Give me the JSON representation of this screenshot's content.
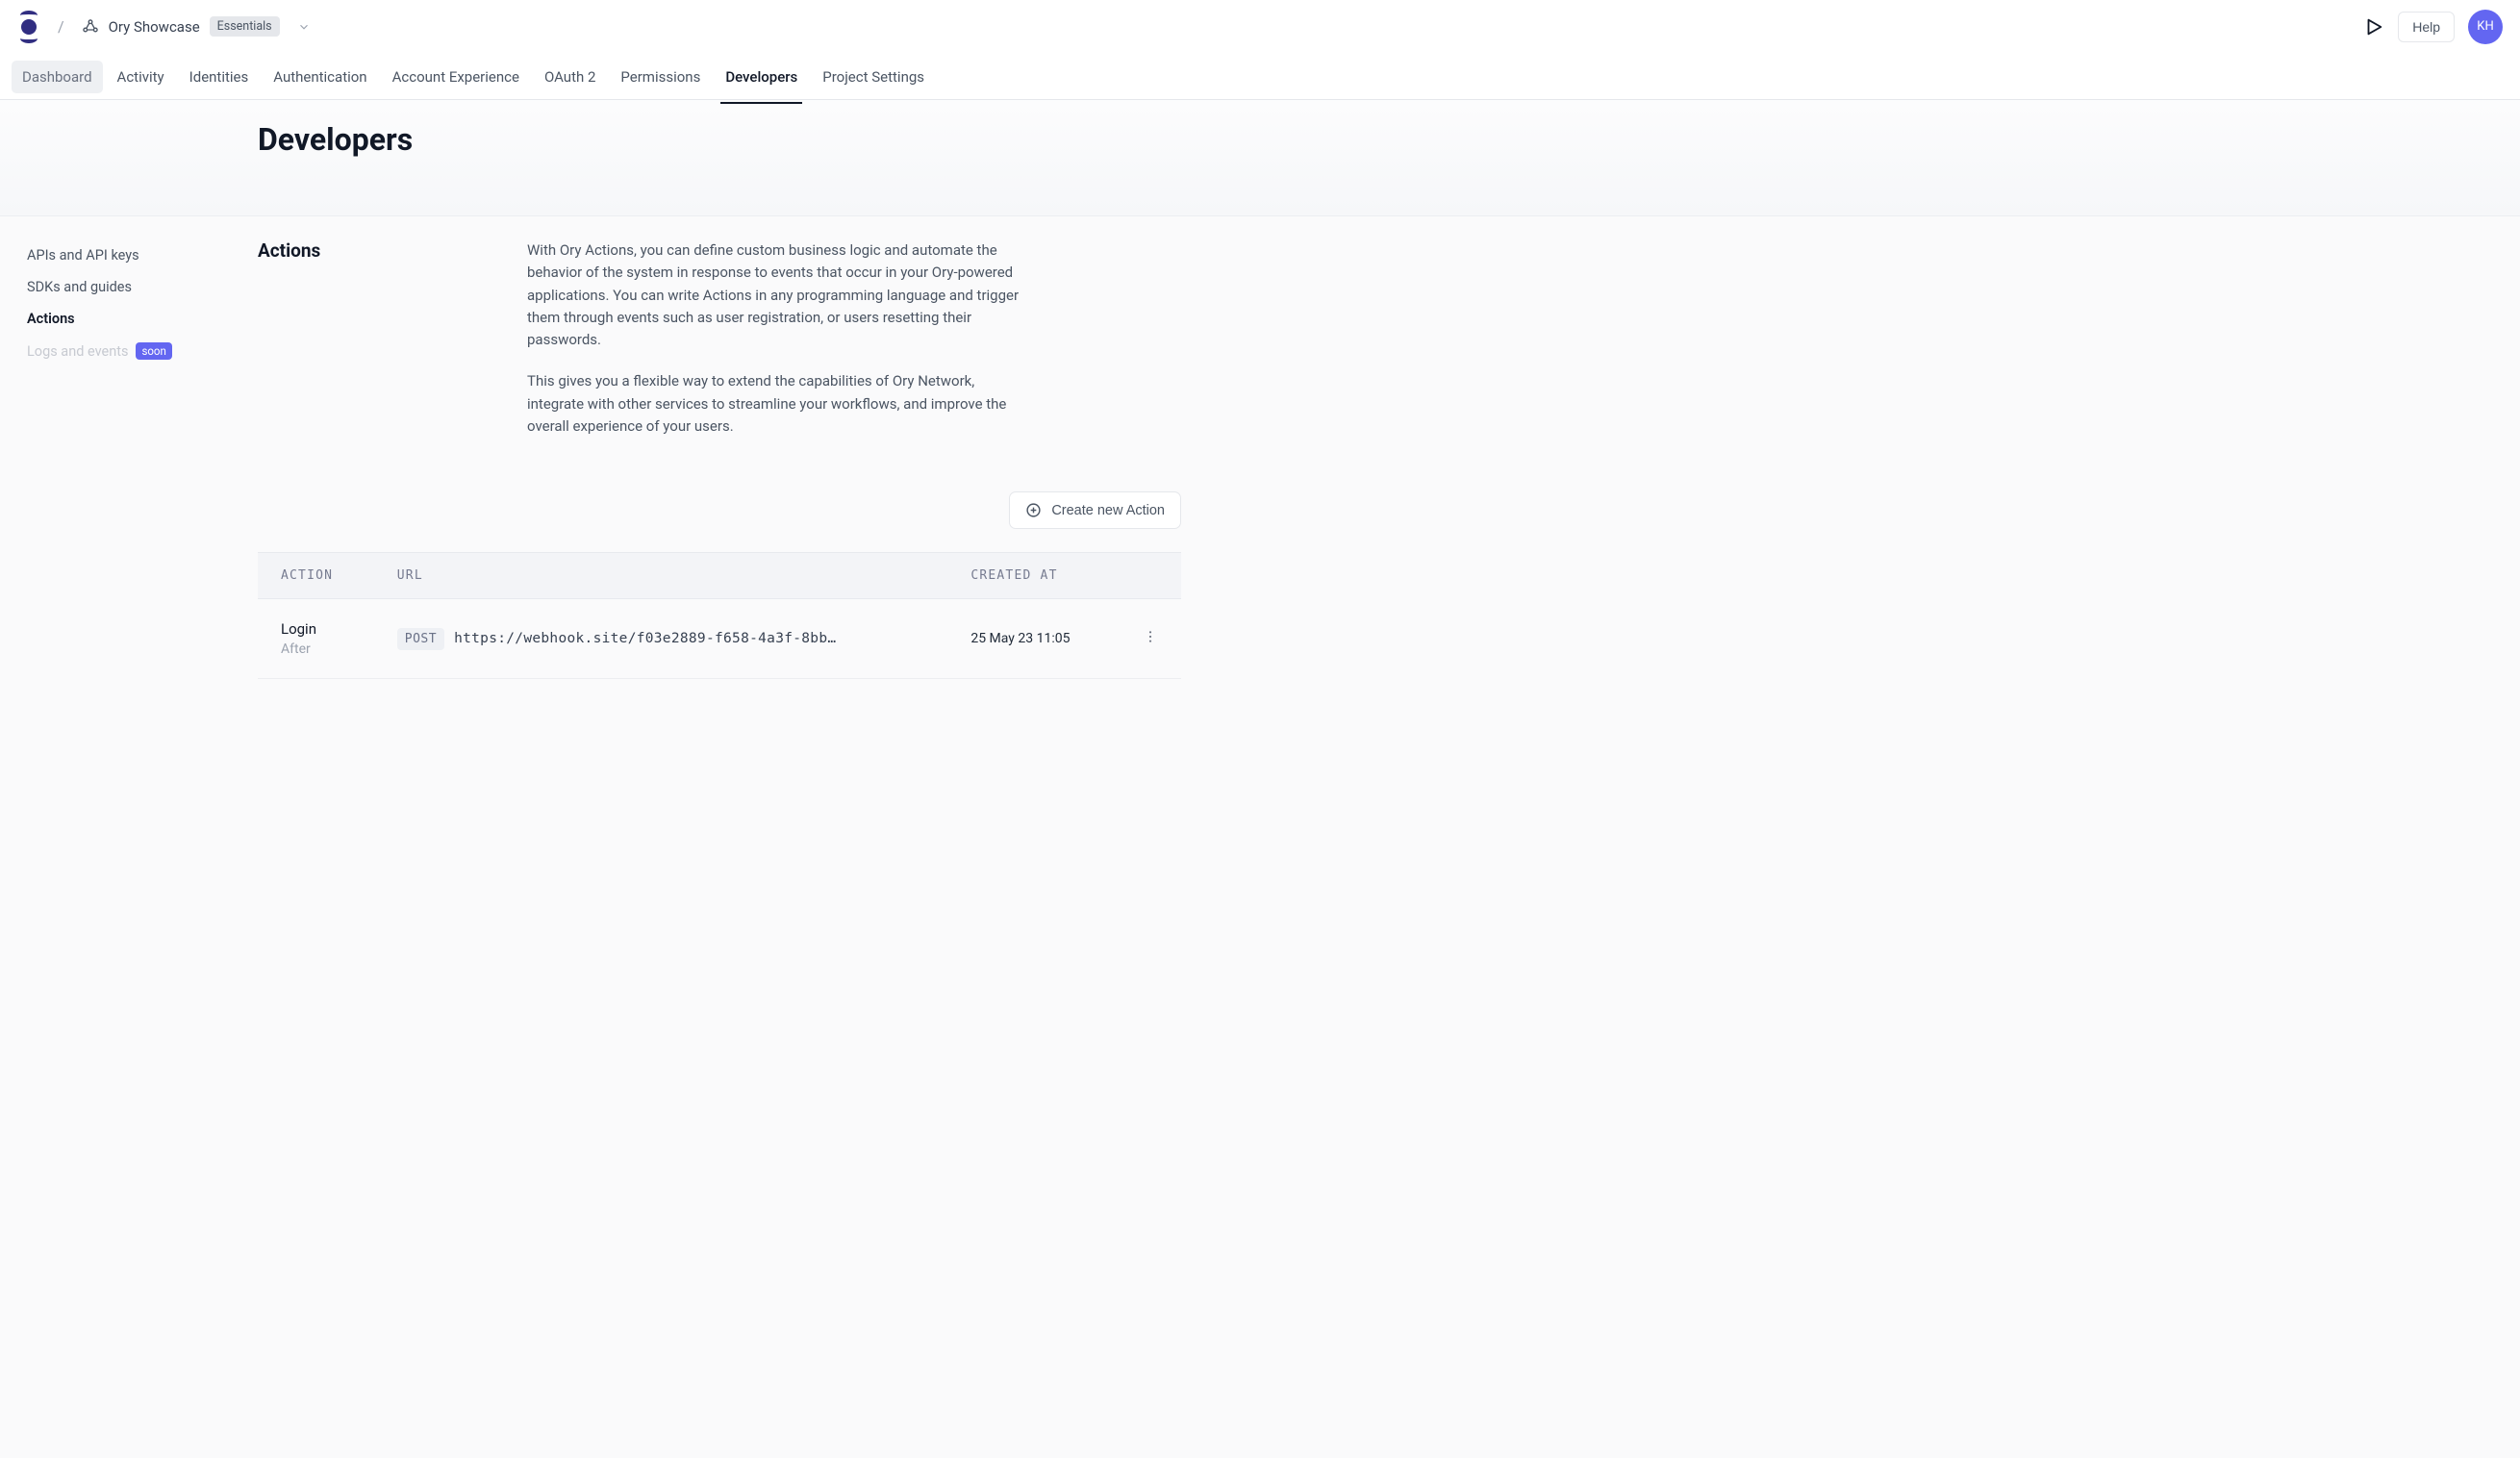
{
  "header": {
    "breadcrumb_separator": "/",
    "project_name": "Ory Showcase",
    "plan_badge": "Essentials",
    "help_label": "Help",
    "avatar_initials": "KH"
  },
  "tabs": [
    {
      "label": "Dashboard",
      "state": "muted"
    },
    {
      "label": "Activity",
      "state": "normal"
    },
    {
      "label": "Identities",
      "state": "normal"
    },
    {
      "label": "Authentication",
      "state": "normal"
    },
    {
      "label": "Account Experience",
      "state": "normal"
    },
    {
      "label": "OAuth 2",
      "state": "normal"
    },
    {
      "label": "Permissions",
      "state": "normal"
    },
    {
      "label": "Developers",
      "state": "active"
    },
    {
      "label": "Project Settings",
      "state": "normal"
    }
  ],
  "page": {
    "title": "Developers"
  },
  "sidenav": {
    "items": [
      {
        "label": "APIs and API keys",
        "state": "normal"
      },
      {
        "label": "SDKs and guides",
        "state": "normal"
      },
      {
        "label": "Actions",
        "state": "active"
      },
      {
        "label": "Logs and events",
        "state": "disabled",
        "badge": "soon"
      }
    ]
  },
  "section": {
    "title": "Actions",
    "desc_p1": "With Ory Actions, you can define custom business logic and automate the behavior of the system in response to events that occur in your Ory-powered applications. You can write Actions in any programming language and trigger them through events such as user registration, or users resetting their passwords.",
    "desc_p2": "This gives you a flexible way to extend the capabilities of Ory Network, integrate with other services to streamline your workflows, and improve the overall experience of your users.",
    "create_button": "Create new Action"
  },
  "table": {
    "columns": [
      "ACTION",
      "URL",
      "CREATED AT"
    ],
    "rows": [
      {
        "action_name": "Login",
        "action_phase": "After",
        "method": "POST",
        "url": "https://webhook.site/f03e2889-f658-4a3f-8bb…",
        "created_at": "25 May 23 11:05"
      }
    ]
  }
}
